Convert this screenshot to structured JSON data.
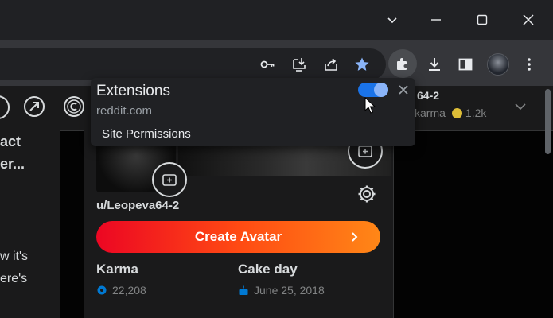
{
  "browser": {
    "tab_search_icon": "chevron-down-icon",
    "controls": {
      "minimize": "minimize-icon",
      "maximize": "maximize-icon",
      "close": "close-icon"
    },
    "toolbar_icons": [
      "key-icon",
      "install-icon",
      "share-icon",
      "star-icon",
      "extensions-icon",
      "download-icon",
      "sidepanel-icon",
      "profile-avatar",
      "kebab-menu-icon"
    ]
  },
  "popup": {
    "title": "Extensions",
    "site": "reddit.com",
    "site_permissions": "Site Permissions",
    "toggle_on": true
  },
  "subheader": {
    "username": "64-2",
    "karma_label": "karma",
    "karma_value": "1.2k"
  },
  "left_panel": {
    "line1": "act",
    "line2": "er...",
    "line3": "w it's",
    "line4": "ere's"
  },
  "profile": {
    "username": "u/Leopeva64-2",
    "create_avatar": "Create Avatar",
    "karma_title": "Karma",
    "karma_value": "22,208",
    "cakeday_title": "Cake day",
    "cakeday_value": "June 25, 2018"
  },
  "colors": {
    "accent_blue": "#8ab4f8",
    "toggle_blue": "#1a73e8",
    "create_gradient_start": "#ec0623",
    "create_gradient_end": "#ff8717",
    "reddit_blue": "#0079d3"
  }
}
